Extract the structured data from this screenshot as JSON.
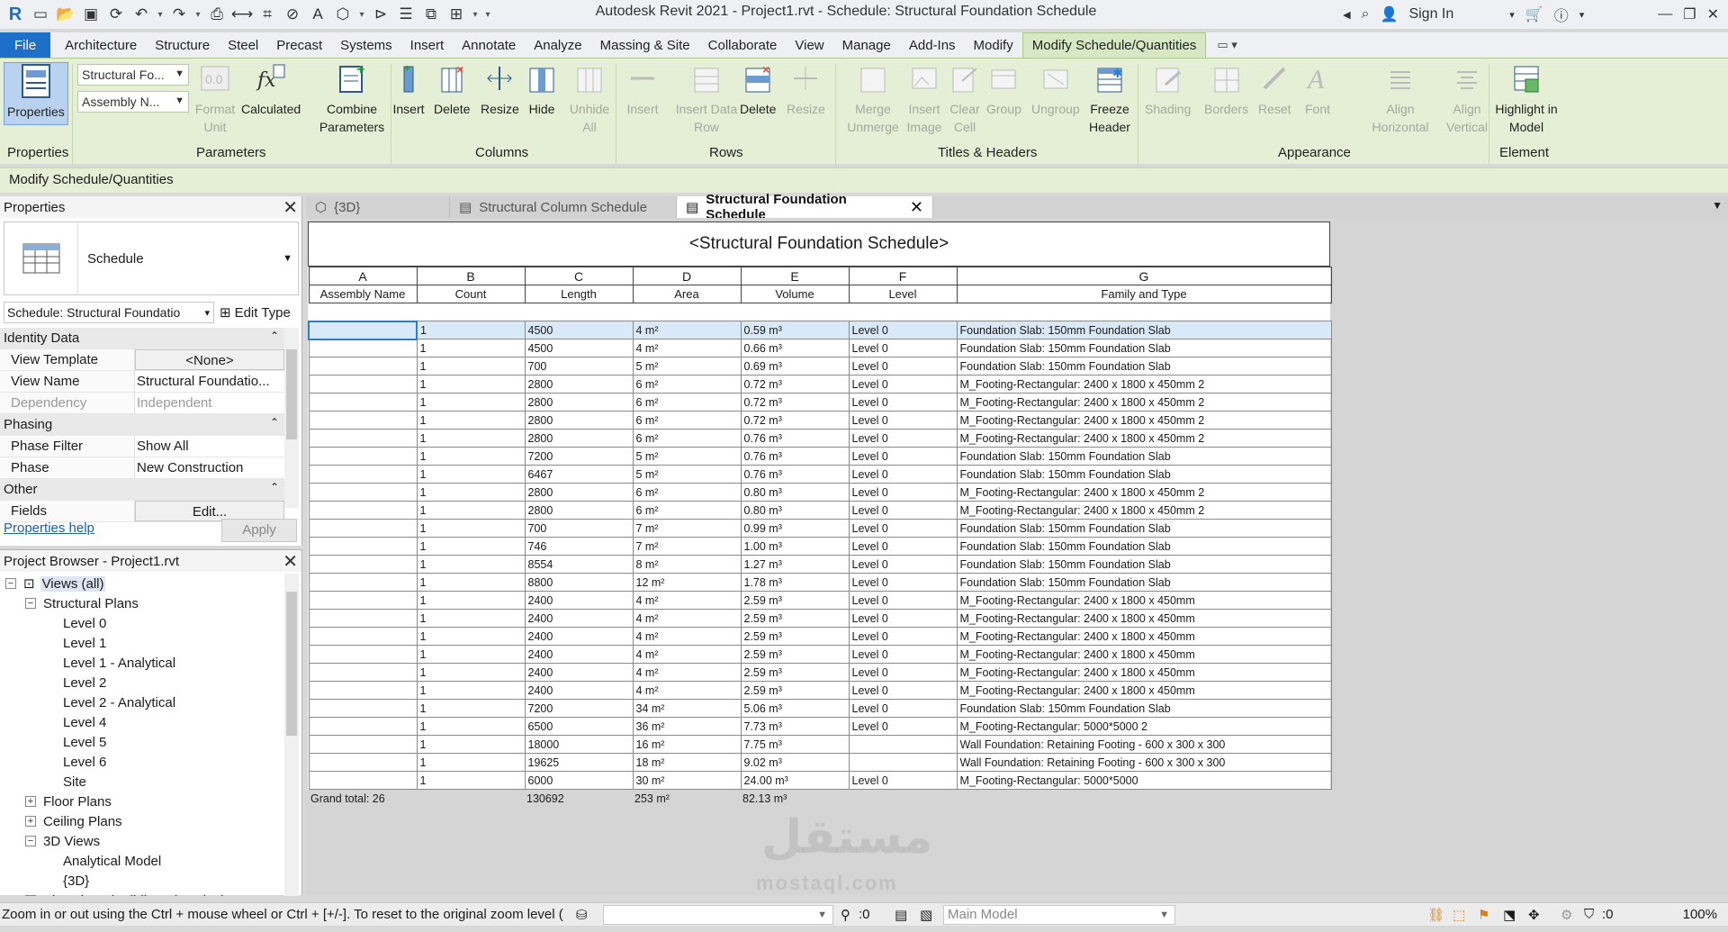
{
  "window": {
    "title": "Autodesk Revit 2021 - Project1.rvt - Schedule: Structural Foundation Schedule",
    "sign_in": "Sign In"
  },
  "menu_tabs": [
    "File",
    "Architecture",
    "Structure",
    "Steel",
    "Precast",
    "Systems",
    "Insert",
    "Annotate",
    "Analyze",
    "Massing & Site",
    "Collaborate",
    "View",
    "Manage",
    "Add-Ins",
    "Modify",
    "Modify Schedule/Quantities"
  ],
  "ribbon": {
    "properties_button": "Properties",
    "type_dropdown": "Structural Fo...",
    "param_dropdown": "Assembly N...",
    "buttons": {
      "format_unit": "Format Unit",
      "calculated": "Calculated",
      "combine_parameters": "Combine Parameters",
      "insert_col": "Insert",
      "delete_col": "Delete",
      "resize_col": "Resize",
      "hide": "Hide",
      "unhide_all": "Unhide All",
      "insert_row": "Insert",
      "insert_data_row": "Insert Data Row",
      "delete_row": "Delete",
      "resize_row": "Resize",
      "merge_unmerge": "Merge Unmerge",
      "insert_image": "Insert Image",
      "clear_cell": "Clear Cell",
      "group": "Group",
      "ungroup": "Ungroup",
      "freeze_header": "Freeze Header",
      "shading": "Shading",
      "borders": "Borders",
      "reset": "Reset",
      "font": "Font",
      "align_horizontal": "Align Horizontal",
      "align_vertical": "Align Vertical",
      "highlight_in_model": "Highlight in Model"
    },
    "panels": {
      "properties": "Properties",
      "parameters": "Parameters",
      "columns": "Columns",
      "rows": "Rows",
      "titles_headers": "Titles & Headers",
      "appearance": "Appearance",
      "element": "Element"
    }
  },
  "context_bar": "Modify Schedule/Quantities",
  "properties_panel": {
    "title": "Properties",
    "type_name": "Schedule",
    "instance_selector": "Schedule: Structural Foundatio",
    "edit_type": "Edit Type",
    "groups": [
      {
        "name": "Identity Data",
        "rows": [
          {
            "key": "View Template",
            "value": "<None>",
            "button": true,
            "disabled": false
          },
          {
            "key": "View Name",
            "value": "Structural Foundatio...",
            "button": false,
            "disabled": false
          },
          {
            "key": "Dependency",
            "value": "Independent",
            "button": false,
            "disabled": true
          }
        ]
      },
      {
        "name": "Phasing",
        "rows": [
          {
            "key": "Phase Filter",
            "value": "Show All",
            "button": false,
            "disabled": false
          },
          {
            "key": "Phase",
            "value": "New Construction",
            "button": false,
            "disabled": false
          }
        ]
      },
      {
        "name": "Other",
        "rows": [
          {
            "key": "Fields",
            "value": "Edit...",
            "button": true,
            "disabled": false
          }
        ]
      }
    ],
    "help_link": "Properties help",
    "apply": "Apply"
  },
  "project_browser": {
    "title": "Project Browser - Project1.rvt",
    "nodes": [
      {
        "label": "Views (all)",
        "level": 0,
        "toggle": "−",
        "selected": true
      },
      {
        "label": "Structural Plans",
        "level": 1,
        "toggle": "−",
        "selected": false
      },
      {
        "label": "Level 0",
        "level": 2,
        "toggle": "",
        "selected": false
      },
      {
        "label": "Level 1",
        "level": 2,
        "toggle": "",
        "selected": false
      },
      {
        "label": "Level 1 - Analytical",
        "level": 2,
        "toggle": "",
        "selected": false
      },
      {
        "label": "Level 2",
        "level": 2,
        "toggle": "",
        "selected": false
      },
      {
        "label": "Level 2 - Analytical",
        "level": 2,
        "toggle": "",
        "selected": false
      },
      {
        "label": "Level 4",
        "level": 2,
        "toggle": "",
        "selected": false
      },
      {
        "label": "Level 5",
        "level": 2,
        "toggle": "",
        "selected": false
      },
      {
        "label": "Level 6",
        "level": 2,
        "toggle": "",
        "selected": false
      },
      {
        "label": "Site",
        "level": 2,
        "toggle": "",
        "selected": false
      },
      {
        "label": "Floor Plans",
        "level": 1,
        "toggle": "+",
        "selected": false
      },
      {
        "label": "Ceiling Plans",
        "level": 1,
        "toggle": "+",
        "selected": false
      },
      {
        "label": "3D Views",
        "level": 1,
        "toggle": "−",
        "selected": false
      },
      {
        "label": "Analytical Model",
        "level": 2,
        "toggle": "",
        "selected": false
      },
      {
        "label": "{3D}",
        "level": 2,
        "toggle": "",
        "selected": false
      },
      {
        "label": "Elevations (Building Elevation)",
        "level": 1,
        "toggle": "−",
        "selected": false
      }
    ]
  },
  "doc_tabs": [
    {
      "label": "{3D}",
      "active": false
    },
    {
      "label": "Structural Column Schedule",
      "active": false
    },
    {
      "label": "Structural Foundation Schedule",
      "active": true
    }
  ],
  "schedule": {
    "title": "<Structural Foundation Schedule>",
    "letters": [
      "A",
      "B",
      "C",
      "D",
      "E",
      "F",
      "G"
    ],
    "headers": [
      "Assembly Name",
      "Count",
      "Length",
      "Area",
      "Volume",
      "Level",
      "Family and Type"
    ],
    "rows": [
      [
        "",
        "1",
        "4500",
        "4 m²",
        "0.59 m³",
        "Level 0",
        "Foundation Slab: 150mm Foundation Slab"
      ],
      [
        "",
        "1",
        "4500",
        "4 m²",
        "0.66 m³",
        "Level 0",
        "Foundation Slab: 150mm Foundation Slab"
      ],
      [
        "",
        "1",
        "700",
        "5 m²",
        "0.69 m³",
        "Level 0",
        "Foundation Slab: 150mm Foundation Slab"
      ],
      [
        "",
        "1",
        "2800",
        "6 m²",
        "0.72 m³",
        "Level 0",
        "M_Footing-Rectangular: 2400 x 1800 x 450mm 2"
      ],
      [
        "",
        "1",
        "2800",
        "6 m²",
        "0.72 m³",
        "Level 0",
        "M_Footing-Rectangular: 2400 x 1800 x 450mm 2"
      ],
      [
        "",
        "1",
        "2800",
        "6 m²",
        "0.72 m³",
        "Level 0",
        "M_Footing-Rectangular: 2400 x 1800 x 450mm 2"
      ],
      [
        "",
        "1",
        "2800",
        "6 m²",
        "0.76 m³",
        "Level 0",
        "M_Footing-Rectangular: 2400 x 1800 x 450mm 2"
      ],
      [
        "",
        "1",
        "7200",
        "5 m²",
        "0.76 m³",
        "Level 0",
        "Foundation Slab: 150mm Foundation Slab"
      ],
      [
        "",
        "1",
        "6467",
        "5 m²",
        "0.76 m³",
        "Level 0",
        "Foundation Slab: 150mm Foundation Slab"
      ],
      [
        "",
        "1",
        "2800",
        "6 m²",
        "0.80 m³",
        "Level 0",
        "M_Footing-Rectangular: 2400 x 1800 x 450mm 2"
      ],
      [
        "",
        "1",
        "2800",
        "6 m²",
        "0.80 m³",
        "Level 0",
        "M_Footing-Rectangular: 2400 x 1800 x 450mm 2"
      ],
      [
        "",
        "1",
        "700",
        "7 m²",
        "0.99 m³",
        "Level 0",
        "Foundation Slab: 150mm Foundation Slab"
      ],
      [
        "",
        "1",
        "746",
        "7 m²",
        "1.00 m³",
        "Level 0",
        "Foundation Slab: 150mm Foundation Slab"
      ],
      [
        "",
        "1",
        "8554",
        "8 m²",
        "1.27 m³",
        "Level 0",
        "Foundation Slab: 150mm Foundation Slab"
      ],
      [
        "",
        "1",
        "8800",
        "12 m²",
        "1.78 m³",
        "Level 0",
        "Foundation Slab: 150mm Foundation Slab"
      ],
      [
        "",
        "1",
        "2400",
        "4 m²",
        "2.59 m³",
        "Level 0",
        "M_Footing-Rectangular: 2400 x 1800 x 450mm"
      ],
      [
        "",
        "1",
        "2400",
        "4 m²",
        "2.59 m³",
        "Level 0",
        "M_Footing-Rectangular: 2400 x 1800 x 450mm"
      ],
      [
        "",
        "1",
        "2400",
        "4 m²",
        "2.59 m³",
        "Level 0",
        "M_Footing-Rectangular: 2400 x 1800 x 450mm"
      ],
      [
        "",
        "1",
        "2400",
        "4 m²",
        "2.59 m³",
        "Level 0",
        "M_Footing-Rectangular: 2400 x 1800 x 450mm"
      ],
      [
        "",
        "1",
        "2400",
        "4 m²",
        "2.59 m³",
        "Level 0",
        "M_Footing-Rectangular: 2400 x 1800 x 450mm"
      ],
      [
        "",
        "1",
        "2400",
        "4 m²",
        "2.59 m³",
        "Level 0",
        "M_Footing-Rectangular: 2400 x 1800 x 450mm"
      ],
      [
        "",
        "1",
        "7200",
        "34 m²",
        "5.06 m³",
        "Level 0",
        "Foundation Slab: 150mm Foundation Slab"
      ],
      [
        "",
        "1",
        "6500",
        "36 m²",
        "7.73 m³",
        "Level 0",
        "M_Footing-Rectangular: 5000*5000 2"
      ],
      [
        "",
        "1",
        "18000",
        "16 m²",
        "7.75 m³",
        "",
        "Wall Foundation: Retaining Footing - 600 x 300 x 300"
      ],
      [
        "",
        "1",
        "19625",
        "18 m²",
        "9.02 m³",
        "",
        "Wall Foundation: Retaining Footing - 600 x 300 x 300"
      ],
      [
        "",
        "1",
        "6000",
        "30 m²",
        "24.00 m³",
        "Level 0",
        "M_Footing-Rectangular: 5000*5000"
      ]
    ],
    "grand_total": {
      "label": "Grand total: 26",
      "length": "130692",
      "area": "253 m²",
      "volume": "82.13 m³"
    }
  },
  "watermark": {
    "line1": "مستقل",
    "line2": "mostaql.com"
  },
  "status_bar": {
    "message": "Zoom in or out using the Ctrl + mouse wheel or Ctrl + [+/-]. To reset to the original zoom level (",
    "worksets": ":0",
    "model": "Main Model",
    "filter_count": ":0",
    "zoom": "100%"
  }
}
